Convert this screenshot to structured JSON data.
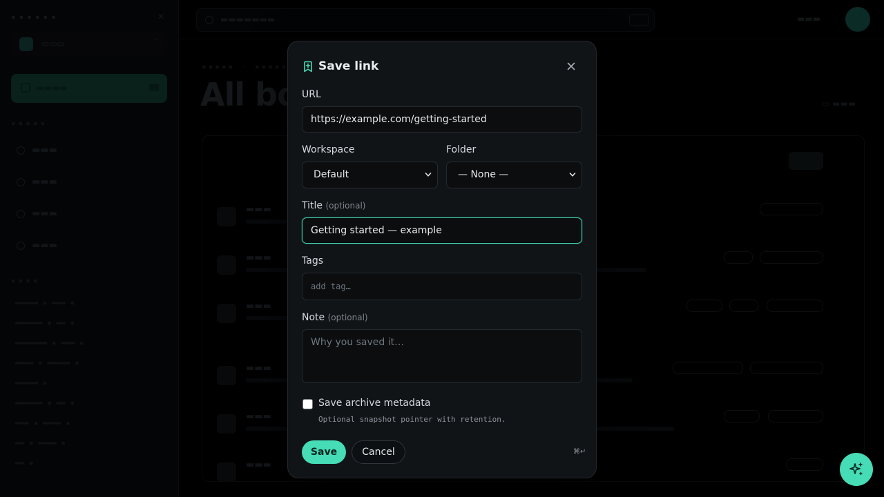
{
  "dialog": {
    "title": "Save link",
    "url_label": "URL",
    "url_value": "https://example.com/getting-started",
    "workspace_label": "Workspace",
    "workspace_value": "Default",
    "folder_label": "Folder",
    "folder_value": "— None —",
    "title_label": "Title",
    "optional_hint": "(optional)",
    "title_value": "Getting started — example",
    "tags_label": "Tags",
    "tags_placeholder": "add tag…",
    "note_label": "Note",
    "note_placeholder": "Why you saved it…",
    "archive_label": "Save archive metadata",
    "archive_checked": false,
    "archive_help": "Optional snapshot pointer with retention.",
    "save_label": "Save",
    "cancel_label": "Cancel",
    "shortcut_hint": "⌘↵"
  },
  "background": {
    "page_title": "All bo"
  },
  "icons": {
    "dialog": "bookmark-plus-icon",
    "close": "close-icon",
    "fab": "sparkles-icon"
  },
  "colors": {
    "accent": "#46dcb6",
    "modal_bg": "#111417",
    "field_bg": "#0b0d0f",
    "focus_border": "#3fd6b3"
  }
}
